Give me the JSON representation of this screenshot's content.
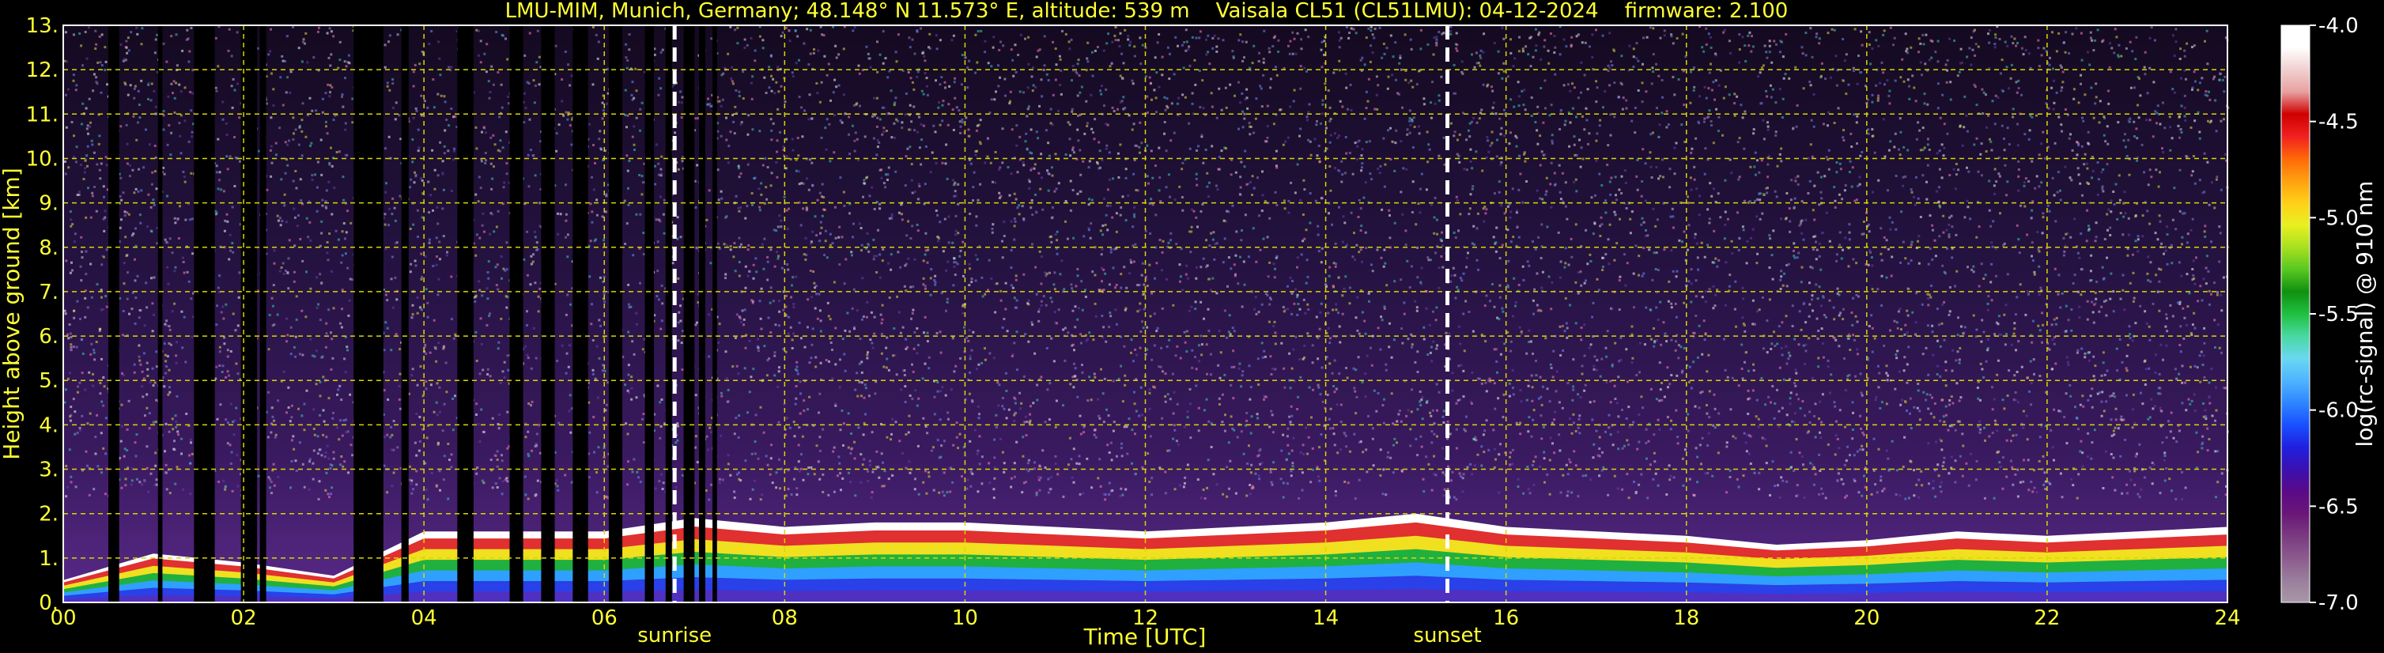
{
  "chart_data": {
    "type": "heatmap",
    "title": "LMU-MIM, Munich, Germany; 48.148° N 11.573° E, altitude: 539 m    Vaisala CL51 (CL51LMU): 04-12-2024    firmware: 2.100",
    "xlabel": "Time [UTC]",
    "ylabel": "Height above ground [km]",
    "xlim": [
      0,
      24
    ],
    "ylim": [
      0,
      13
    ],
    "x_ticks": [
      "00",
      "02",
      "04",
      "06",
      "08",
      "10",
      "12",
      "14",
      "16",
      "18",
      "20",
      "22",
      "24"
    ],
    "y_ticks": [
      "0.",
      "1.",
      "2.",
      "3.",
      "4.",
      "5.",
      "6.",
      "7.",
      "8.",
      "9.",
      "10.",
      "11.",
      "12.",
      "13."
    ],
    "grid": true,
    "colorbar": {
      "label": "log(rc-signal) @ 910 nm",
      "range": [
        -7.0,
        -4.0
      ],
      "ticks": [
        "-4.0",
        "-4.5",
        "-5.0",
        "-5.5",
        "-6.0",
        "-6.5",
        "-7.0"
      ],
      "colors": [
        "#a898a8",
        "#9a7e9c",
        "#8c5a8e",
        "#7a3a80",
        "#6a1678",
        "#5a0a88",
        "#3a10b0",
        "#2020e0",
        "#1850ff",
        "#2f86ff",
        "#4fb4ff",
        "#6ad8f0",
        "#48d8a0",
        "#20c040",
        "#109010",
        "#58c820",
        "#a8e020",
        "#e8f020",
        "#ffd018",
        "#ffa010",
        "#ff6808",
        "#f02020",
        "#d00000",
        "#e8a0a0",
        "#f0d0d0",
        "#ffffff",
        "#ffffff"
      ]
    },
    "annotations": [
      {
        "label": "sunrise",
        "x": 6.78
      },
      {
        "label": "sunset",
        "x": 15.35
      }
    ],
    "series": [
      {
        "name": "data gaps (no signal)",
        "intervals": [
          [
            0.5,
            0.62
          ],
          [
            1.05,
            1.1
          ],
          [
            1.45,
            1.68
          ],
          [
            1.97,
            2.15
          ],
          [
            2.18,
            2.25
          ],
          [
            3.22,
            3.55
          ],
          [
            3.75,
            3.83
          ],
          [
            4.37,
            4.55
          ],
          [
            4.95,
            5.1
          ],
          [
            5.3,
            5.45
          ],
          [
            5.65,
            5.82
          ],
          [
            6.05,
            6.2
          ],
          [
            6.45,
            6.55
          ],
          [
            6.68,
            6.75
          ],
          [
            6.88,
            7.0
          ],
          [
            7.05,
            7.12
          ],
          [
            7.2,
            7.25
          ]
        ]
      },
      {
        "name": "aerosol boundary layer top (km)",
        "x": [
          0,
          1,
          2,
          3,
          4,
          5,
          6,
          7,
          8,
          9,
          10,
          11,
          12,
          13,
          14,
          15,
          16,
          17,
          18,
          19,
          20,
          21,
          22,
          23,
          24
        ],
        "values": [
          0.5,
          1.1,
          0.9,
          0.6,
          1.6,
          1.6,
          1.6,
          1.9,
          1.7,
          1.8,
          1.8,
          1.7,
          1.6,
          1.7,
          1.8,
          2.0,
          1.7,
          1.6,
          1.5,
          1.3,
          1.4,
          1.6,
          1.5,
          1.6,
          1.7
        ]
      }
    ]
  }
}
